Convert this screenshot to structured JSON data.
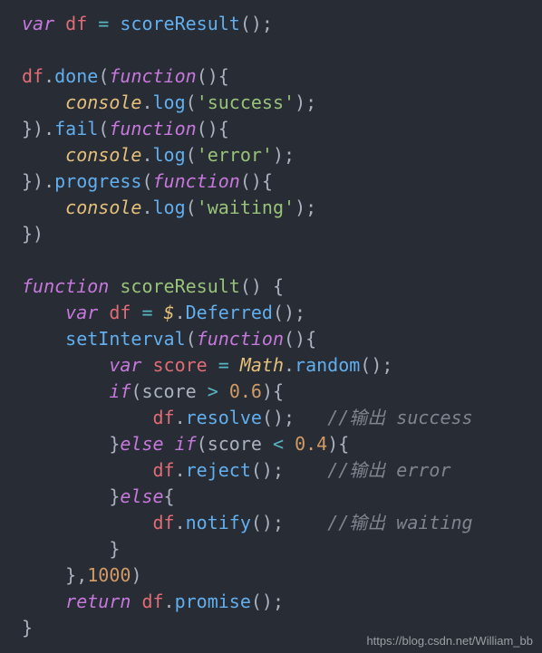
{
  "lines": {
    "l1_var": "var",
    "l1_df": "df",
    "l1_eq": " = ",
    "l1_fn": "scoreResult",
    "l1_tail": "();",
    "l3_df": "df",
    "l3_dot": ".",
    "l3_done": "done",
    "l3_p1": "(",
    "l3_func": "function",
    "l3_tail": "(){",
    "l4_pad": "    ",
    "l4_console": "console",
    "l4_dot": ".",
    "l4_log": "log",
    "l4_p1": "(",
    "l4_str": "'success'",
    "l4_tail": ");",
    "l5_head": "}).",
    "l5_fail": "fail",
    "l5_p1": "(",
    "l5_func": "function",
    "l5_tail": "(){",
    "l6_pad": "    ",
    "l6_console": "console",
    "l6_dot": ".",
    "l6_log": "log",
    "l6_p1": "(",
    "l6_str": "'error'",
    "l6_tail": ");",
    "l7_head": "}).",
    "l7_prog": "progress",
    "l7_p1": "(",
    "l7_func": "function",
    "l7_tail": "(){",
    "l8_pad": "    ",
    "l8_console": "console",
    "l8_dot": ".",
    "l8_log": "log",
    "l8_p1": "(",
    "l8_str": "'waiting'",
    "l8_tail": ");",
    "l9": "})",
    "l11_func": "function",
    "l11_name": " scoreResult",
    "l11_tail": "() {",
    "l12_pad": "    ",
    "l12_var": "var",
    "l12_df": " df",
    "l12_eq": " = ",
    "l12_dollar": "$",
    "l12_dot": ".",
    "l12_def": "Deferred",
    "l12_tail": "();",
    "l13_pad": "    ",
    "l13_set": "setInterval",
    "l13_p1": "(",
    "l13_func": "function",
    "l13_tail": "(){",
    "l14_pad": "        ",
    "l14_var": "var",
    "l14_score": " score",
    "l14_eq": " = ",
    "l14_math": "Math",
    "l14_dot": ".",
    "l14_rand": "random",
    "l14_tail": "();",
    "l15_pad": "        ",
    "l15_if": "if",
    "l15_p1": "(score ",
    "l15_op": ">",
    "l15_sp": " ",
    "l15_num": "0.6",
    "l15_tail": "){",
    "l16_pad": "            ",
    "l16_df": "df",
    "l16_dot": ".",
    "l16_res": "resolve",
    "l16_tail": "();",
    "l16_gap": "   ",
    "l16_cmt": "//输出 success",
    "l17_pad": "        ",
    "l17_close": "}",
    "l17_else": "else if",
    "l17_p1": "(score ",
    "l17_op": "<",
    "l17_sp": " ",
    "l17_num": "0.4",
    "l17_tail": "){",
    "l18_pad": "            ",
    "l18_df": "df",
    "l18_dot": ".",
    "l18_rej": "reject",
    "l18_tail": "();",
    "l18_gap": "    ",
    "l18_cmt": "//输出 error",
    "l19_pad": "        ",
    "l19_close": "}",
    "l19_else": "else",
    "l19_tail": "{",
    "l20_pad": "            ",
    "l20_df": "df",
    "l20_dot": ".",
    "l20_not": "notify",
    "l20_tail": "();",
    "l20_gap": "    ",
    "l20_cmt": "//输出 waiting",
    "l21_pad": "        ",
    "l21": "}",
    "l22_pad": "    ",
    "l22_head": "},",
    "l22_num": "1000",
    "l22_tail": ")",
    "l23_pad": "    ",
    "l23_ret": "return",
    "l23_df": " df",
    "l23_dot": ".",
    "l23_prom": "promise",
    "l23_tail": "();",
    "l24": "}"
  },
  "watermark": "https://blog.csdn.net/William_bb"
}
